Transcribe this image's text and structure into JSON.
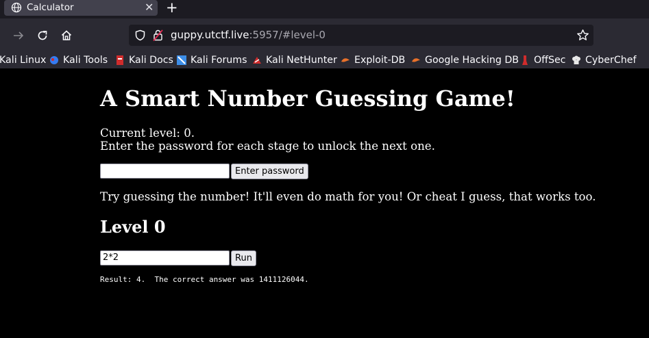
{
  "browser": {
    "tab": {
      "title": "Calculator",
      "close_symbol": "✕"
    },
    "new_tab_symbol": "+",
    "url": {
      "host": "guppy.utctf.live",
      "rest": ":5957/#level-0"
    },
    "bookmarks": [
      {
        "label": "Kali Linux",
        "icon": "kali-icon",
        "color": "#367bf0"
      },
      {
        "label": "Kali Tools",
        "icon": "kali-tools-icon",
        "color": "#367bf0"
      },
      {
        "label": "Kali Docs",
        "icon": "kali-docs-icon",
        "color": "#d02c2c"
      },
      {
        "label": "Kali Forums",
        "icon": "kali-forums-icon",
        "color": "#3d8ee8"
      },
      {
        "label": "Kali NetHunter",
        "icon": "nethunter-icon",
        "color": "#d02c2c"
      },
      {
        "label": "Exploit-DB",
        "icon": "exploit-db-icon",
        "color": "#e8712a"
      },
      {
        "label": "Google Hacking DB",
        "icon": "ghdb-icon",
        "color": "#e8712a"
      },
      {
        "label": "OffSec",
        "icon": "offsec-icon",
        "color": "#d02c2c"
      },
      {
        "label": "CyberChef",
        "icon": "cyberchef-icon",
        "color": "#e8e8e8"
      }
    ]
  },
  "page": {
    "title": "A Smart Number Guessing Game!",
    "current_level": "Current level: 0.",
    "instructions": "Enter the password for each stage to unlock the next one.",
    "password_input": {
      "value": "",
      "placeholder": ""
    },
    "password_button": "Enter password",
    "hint": "Try guessing the number! It'll even do math for you! Or cheat I guess, that works too.",
    "level_heading": "Level 0",
    "expr_input": {
      "value": "2*2"
    },
    "run_button": "Run",
    "result": "Result: 4.  The correct answer was 1411126044."
  }
}
